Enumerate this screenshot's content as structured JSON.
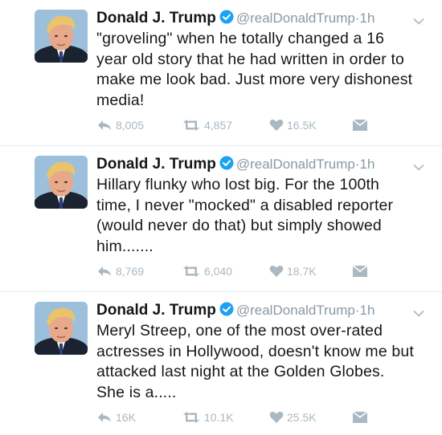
{
  "tweets": [
    {
      "name": "Donald J. Trump",
      "handle": "@realDonaldTrump",
      "separator": "·",
      "time": "1h",
      "text": "\"groveling\" when he totally changed a 16 year old story that he had written in order to make me look bad. Just more very dishonest media!",
      "replies": "8,005",
      "retweets": "4,857",
      "likes": "16.5K"
    },
    {
      "name": "Donald J. Trump",
      "handle": "@realDonaldTrump",
      "separator": "·",
      "time": "1h",
      "text": "Hillary flunky who lost big. For the 100th time, I never \"mocked\" a disabled reporter (would never do that) but simply showed him.......",
      "replies": "8,769",
      "retweets": "6,040",
      "likes": "18.7K"
    },
    {
      "name": "Donald J. Trump",
      "handle": "@realDonaldTrump",
      "separator": "·",
      "time": "1h",
      "text": "Meryl Streep, one of the most over-rated actresses in Hollywood, doesn't know me but attacked last night at the Golden Globes. She is a.....",
      "replies": "16K",
      "retweets": "10.1K",
      "likes": "25.5K"
    }
  ],
  "icons": {
    "verified": "verified-badge-icon",
    "caret": "chevron-down-icon",
    "reply": "reply-icon",
    "retweet": "retweet-icon",
    "like": "heart-icon",
    "dm": "envelope-icon"
  },
  "colors": {
    "text": "#14171a",
    "secondary": "#8899a6",
    "action": "#aab8c2",
    "verified": "#1da1f2",
    "divider": "#e6ecf0"
  }
}
